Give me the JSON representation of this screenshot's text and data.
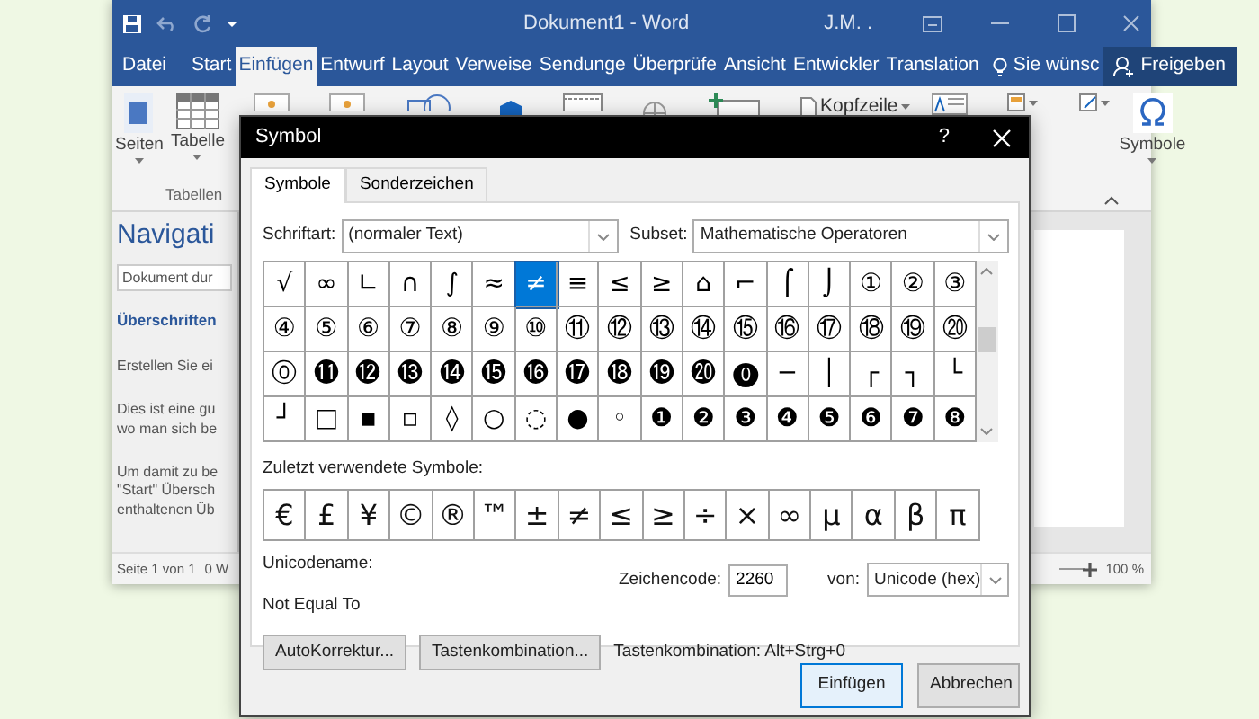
{
  "window": {
    "title": "Dokument1 - Word",
    "user": "J.M. ."
  },
  "ribbon_tabs": [
    {
      "label": "Datei",
      "selected": false
    },
    {
      "label": "Start",
      "selected": false
    },
    {
      "label": "Einfügen",
      "selected": true
    },
    {
      "label": "Entwurf",
      "selected": false
    },
    {
      "label": "Layout",
      "selected": false
    },
    {
      "label": "Verweise",
      "selected": false
    },
    {
      "label": "Sendunge",
      "selected": false
    },
    {
      "label": "Überprüfe",
      "selected": false
    },
    {
      "label": "Ansicht",
      "selected": false
    },
    {
      "label": "Entwickler",
      "selected": false
    },
    {
      "label": "Translation",
      "selected": false
    }
  ],
  "tell_me": "Sie wünsc",
  "share_button": "Freigeben",
  "ribbon": {
    "pages_button": "Seiten",
    "table_button": "Tabelle",
    "group_label": "Tabellen",
    "header_button": "Kopfzeile",
    "symbols_button": "Symbole"
  },
  "navigation": {
    "title": "Navigati",
    "search": {
      "placeholder": "Dokument dur"
    },
    "headings_tab": "Überschriften",
    "paragraphs": [
      [
        "Erstellen Sie ei"
      ],
      [
        "Dies ist eine gu",
        "wo man sich be"
      ],
      [
        "Um damit zu be",
        "\"Start\" Übersch",
        "enthaltenen Üb"
      ]
    ]
  },
  "status_bar": {
    "page": "Seite 1 von 1",
    "words": "0 W",
    "zoom": "100 %"
  },
  "dialog": {
    "title": "Symbol",
    "help": "?",
    "tabs": [
      {
        "label": "Symbole",
        "selected": true
      },
      {
        "label": "Sonderzeichen",
        "selected": false
      }
    ],
    "font_label": "Schriftart:",
    "font_value": "(normaler Text)",
    "subset_label": "Subset:",
    "subset_value": "Mathematische Operatoren",
    "symbols": [
      {
        "char": "√",
        "selected": false
      },
      {
        "char": "∞",
        "selected": false
      },
      {
        "char": "∟",
        "selected": false
      },
      {
        "char": "∩",
        "selected": false
      },
      {
        "char": "∫",
        "selected": false
      },
      {
        "char": "≈",
        "selected": false
      },
      {
        "char": "≠",
        "selected": true
      },
      {
        "char": "≡",
        "selected": false
      },
      {
        "char": "≤",
        "selected": false
      },
      {
        "char": "≥",
        "selected": false
      },
      {
        "char": "⌂",
        "selected": false
      },
      {
        "char": "⌐",
        "selected": false
      },
      {
        "char": "⌠",
        "selected": false
      },
      {
        "char": "⌡",
        "selected": false
      },
      {
        "char": "①",
        "selected": false
      },
      {
        "char": "②",
        "selected": false
      },
      {
        "char": "③",
        "selected": false
      },
      {
        "char": "④",
        "selected": false
      },
      {
        "char": "⑤",
        "selected": false
      },
      {
        "char": "⑥",
        "selected": false
      },
      {
        "char": "⑦",
        "selected": false
      },
      {
        "char": "⑧",
        "selected": false
      },
      {
        "char": "⑨",
        "selected": false
      },
      {
        "char": "⑩",
        "selected": false
      },
      {
        "char": "⑪",
        "selected": false
      },
      {
        "char": "⑫",
        "selected": false
      },
      {
        "char": "⑬",
        "selected": false
      },
      {
        "char": "⑭",
        "selected": false
      },
      {
        "char": "⑮",
        "selected": false
      },
      {
        "char": "⑯",
        "selected": false
      },
      {
        "char": "⑰",
        "selected": false
      },
      {
        "char": "⑱",
        "selected": false
      },
      {
        "char": "⑲",
        "selected": false
      },
      {
        "char": "⑳",
        "selected": false
      },
      {
        "char": "⓪",
        "selected": false
      },
      {
        "char": "⓫",
        "selected": false
      },
      {
        "char": "⓬",
        "selected": false
      },
      {
        "char": "⓭",
        "selected": false
      },
      {
        "char": "⓮",
        "selected": false
      },
      {
        "char": "⓯",
        "selected": false
      },
      {
        "char": "⓰",
        "selected": false
      },
      {
        "char": "⓱",
        "selected": false
      },
      {
        "char": "⓲",
        "selected": false
      },
      {
        "char": "⓳",
        "selected": false
      },
      {
        "char": "⓴",
        "selected": false
      },
      {
        "char": "⓿",
        "selected": false
      },
      {
        "char": "─",
        "selected": false
      },
      {
        "char": "│",
        "selected": false
      },
      {
        "char": "┌",
        "selected": false
      },
      {
        "char": "┐",
        "selected": false
      },
      {
        "char": "└",
        "selected": false
      },
      {
        "char": "┘",
        "selected": false
      },
      {
        "char": "□",
        "selected": false
      },
      {
        "char": "▪",
        "selected": false
      },
      {
        "char": "▫",
        "selected": false
      },
      {
        "char": "◊",
        "selected": false
      },
      {
        "char": "○",
        "selected": false
      },
      {
        "char": "◌",
        "selected": false
      },
      {
        "char": "●",
        "selected": false
      },
      {
        "char": "◦",
        "selected": false
      },
      {
        "char": "❶",
        "selected": false
      },
      {
        "char": "❷",
        "selected": false
      },
      {
        "char": "❸",
        "selected": false
      },
      {
        "char": "❹",
        "selected": false
      },
      {
        "char": "❺",
        "selected": false
      },
      {
        "char": "❻",
        "selected": false
      },
      {
        "char": "❼",
        "selected": false
      },
      {
        "char": "❽",
        "selected": false
      }
    ],
    "recent_label": "Zuletzt verwendete Symbole:",
    "recent": [
      "€",
      "£",
      "¥",
      "©",
      "®",
      "™",
      "±",
      "≠",
      "≤",
      "≥",
      "÷",
      "×",
      "∞",
      "µ",
      "α",
      "β",
      "π"
    ],
    "unicode_name_label": "Unicodename:",
    "unicode_name": "Not Equal To",
    "code_label": "Zeichencode:",
    "code_value": "2260",
    "from_label": "von:",
    "from_value": "Unicode (hex)",
    "buttons": [
      "AutoKorrektur...",
      "Tastenkombination..."
    ],
    "shortcut_text": "Tastenkombination: Alt+Strg+0",
    "ok_button": "Einfügen",
    "cancel_button": "Abbrechen"
  }
}
